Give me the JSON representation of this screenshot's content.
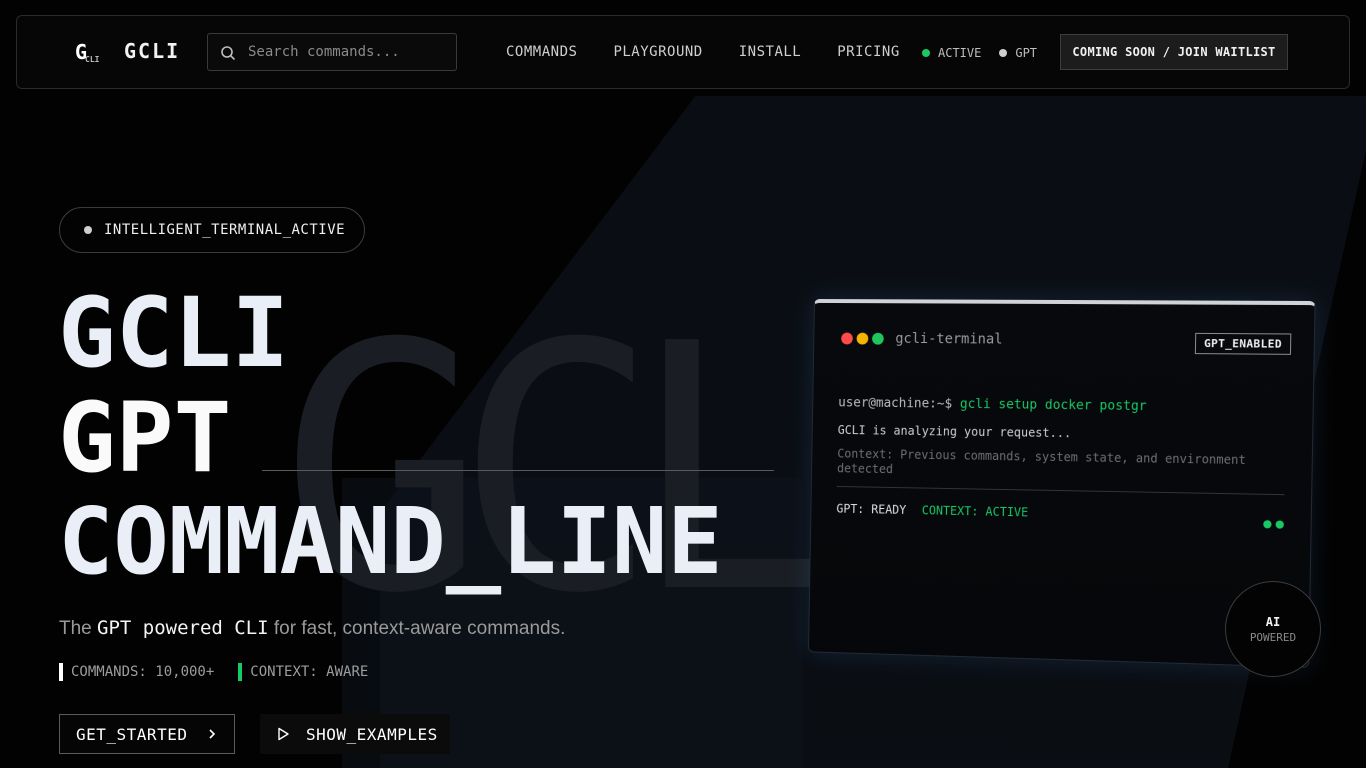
{
  "header": {
    "logo_mark": "G",
    "logo_mark_small": "CLI",
    "brand": "GCLI",
    "search": {
      "placeholder": "Search commands..."
    },
    "nav": [
      {
        "label": "COMMANDS"
      },
      {
        "label": "PLAYGROUND"
      },
      {
        "label": "INSTALL"
      },
      {
        "label": "PRICING"
      }
    ],
    "status": [
      {
        "label": "ACTIVE",
        "color": "#18c964"
      },
      {
        "label": "GPT",
        "color": "#cfcfcf"
      }
    ],
    "cta_label": "COMING SOON / JOIN WAITLIST"
  },
  "hero": {
    "badge_label": "INTELLIGENT_TERMINAL_ACTIVE",
    "background_text": "GCL",
    "title_lines": [
      "GCLI",
      "GPT",
      "COMMAND_LINE"
    ],
    "subtitle": {
      "prefix": "The ",
      "highlight": "GPT powered CLI",
      "suffix": " for fast, context-aware commands."
    },
    "stats": [
      {
        "label": "COMMANDS: 10,000+"
      },
      {
        "label": "CONTEXT: AWARE"
      }
    ],
    "primary_button": "GET_STARTED",
    "secondary_button": "SHOW_EXAMPLES"
  },
  "terminal": {
    "title": "gcli-terminal",
    "badge": "GPT_ENABLED",
    "prompt": "user@machine:~$",
    "command": "gcli setup docker postgr",
    "line1": "GCLI is analyzing your request...",
    "line2": "Context: Previous commands, system state, and environment detected",
    "status_gpt": "GPT: READY",
    "status_context": "CONTEXT: ACTIVE",
    "traffic_lights": [
      "#ff4b4b",
      "#f5b400",
      "#20c55e"
    ]
  },
  "ai_badge": {
    "line1": "AI",
    "line2": "POWERED"
  },
  "colors": {
    "accent_green": "#18c964",
    "background": "#020202"
  }
}
